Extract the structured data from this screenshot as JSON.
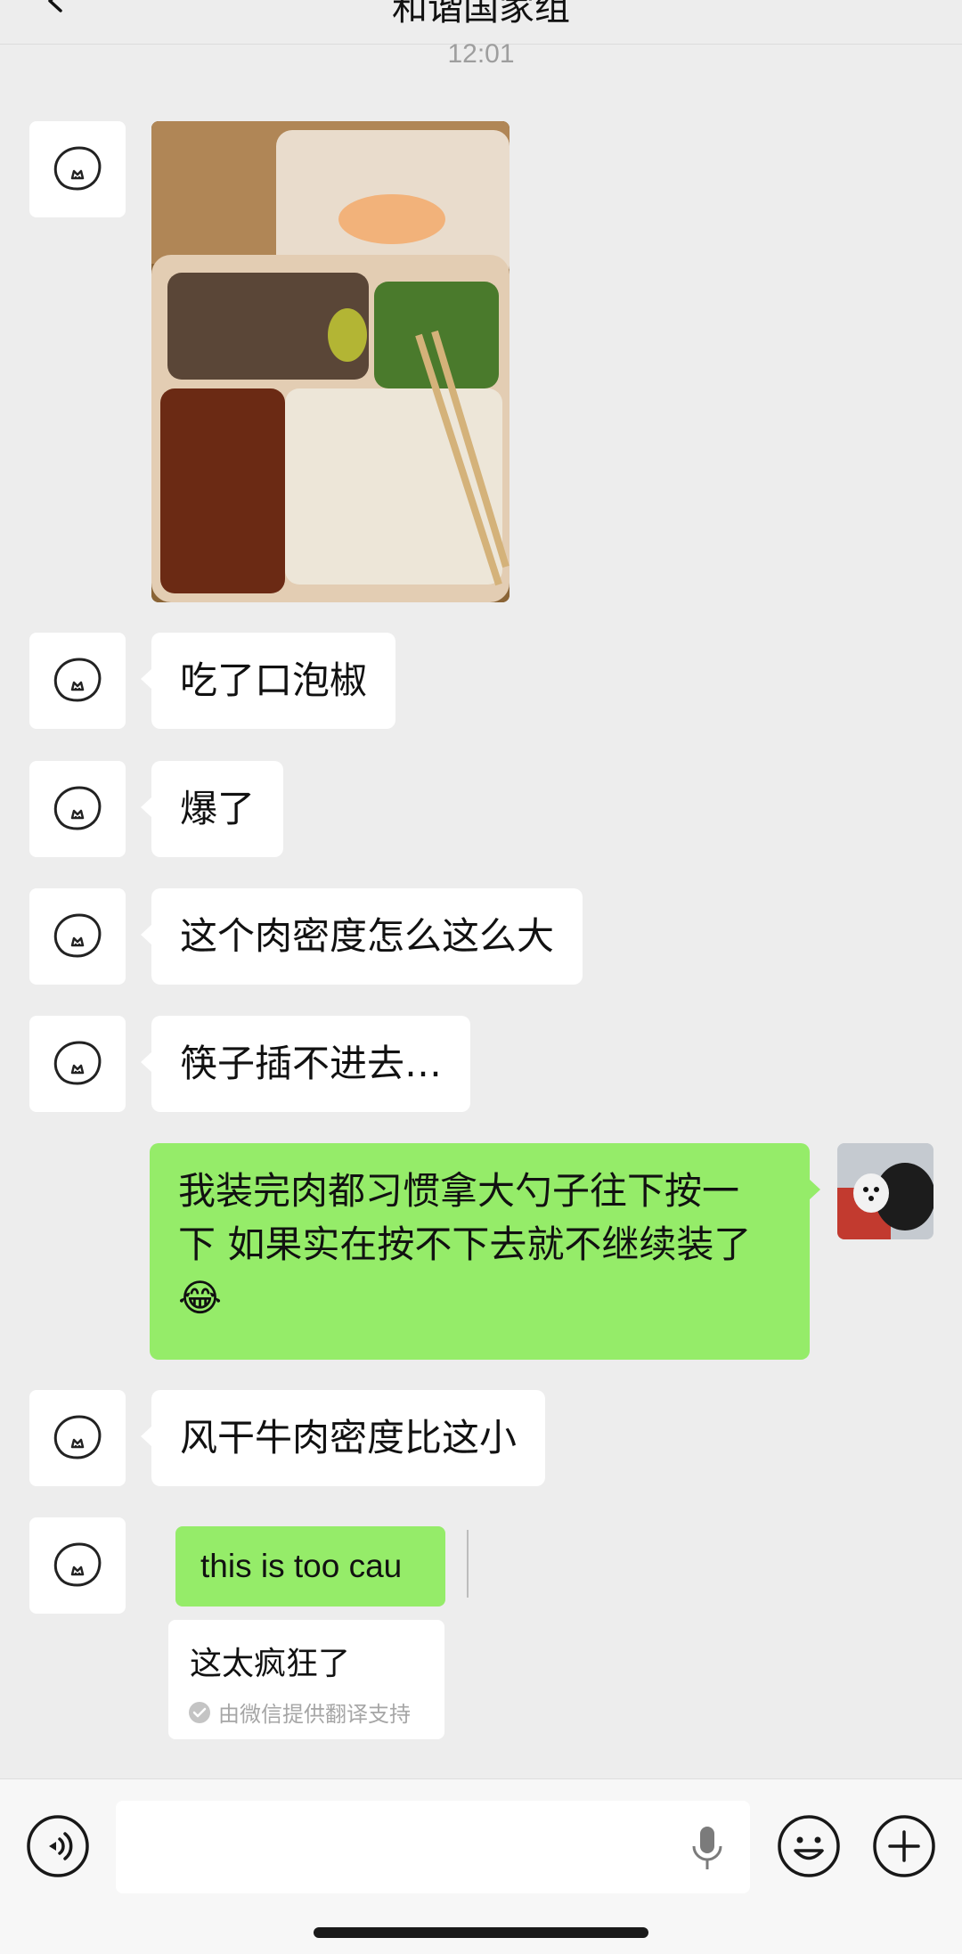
{
  "header": {
    "title": "和谐国家组"
  },
  "timestamp": "12:01",
  "messages": {
    "m1": "吃了口泡椒",
    "m2": "爆了",
    "m3": "这个肉密度怎么这么大",
    "m4": "筷子插不进去…",
    "m5_line1": "我装完肉都习惯拿大勺子往下按一",
    "m5_line2": "下 如果实在按不下去就不继续装了",
    "m5_emoji": "😂",
    "m6": "风干牛肉密度比这小",
    "m7_quote": "this is too cau",
    "m7_translation": "这太疯狂了",
    "m7_translation_note": "由微信提供翻译支持"
  },
  "icons": {
    "back": "chevron-left-icon",
    "contact_avatar": "cat-doodle-avatar",
    "self_avatar": "dogs-photo-avatar",
    "voice": "voice-icon",
    "mic": "mic-icon",
    "emoji": "smiley-icon",
    "plus": "plus-circle-icon",
    "check": "check-circle-icon"
  },
  "colors": {
    "background": "#ededed",
    "incoming_bubble": "#ffffff",
    "outgoing_bubble": "#95ec69",
    "input_bar": "#f7f7f7"
  }
}
